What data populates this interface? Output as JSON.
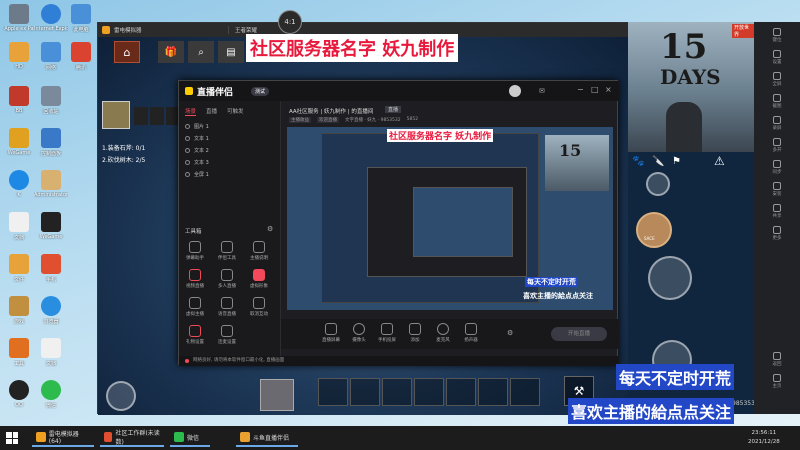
{
  "desktop": {
    "icons": [
      {
        "label": "Apple ex Pa",
        "color": "#6c7a8a"
      },
      {
        "label": "Internet Explorer",
        "color": "#2f7fd6"
      },
      {
        "label": "此电脑",
        "color": "#4a90d9"
      },
      {
        "label": "HD",
        "color": "#e8a23a"
      },
      {
        "label": "网络",
        "color": "#4a90d9"
      },
      {
        "label": "腾讯",
        "color": "#d9432f"
      },
      {
        "label": "BB",
        "color": "#c0392b"
      },
      {
        "label": "回收站",
        "color": "#7a8a9a"
      },
      {
        "label": "WeGame",
        "color": "#e0a020"
      },
      {
        "label": "控制面板",
        "color": "#3a78c8"
      },
      {
        "label": "K",
        "color": "#1e88e5"
      },
      {
        "label": "Administrator",
        "color": "#d8b070"
      },
      {
        "label": "文档",
        "color": "#f0f0f0"
      },
      {
        "label": "WeGame",
        "color": "#222"
      },
      {
        "label": "文件",
        "color": "#e8a23a"
      },
      {
        "label": "手机",
        "color": "#e05030"
      },
      {
        "label": "游戏",
        "color": "#c09040"
      },
      {
        "label": "浏览器",
        "color": "#2a8ee0"
      },
      {
        "label": "工具",
        "color": "#e07020"
      },
      {
        "label": "文档",
        "color": "#f0f0f0"
      },
      {
        "label": "QQ",
        "color": "#222"
      },
      {
        "label": "微信",
        "color": "#2dbb4e"
      }
    ]
  },
  "emulator": {
    "title": "雷电模拟器",
    "tab": "王者荣耀",
    "clock": "4:1",
    "quests": [
      "1.装备石斧: 0/1",
      "2.砍伐树木: 2/5"
    ]
  },
  "stream_app": {
    "logo": "直播伴侣",
    "badge": "测试",
    "left_tabs": [
      "场景",
      "直播",
      "可触发"
    ],
    "layers": [
      "图片 1",
      "文本 1",
      "文本 2",
      "文本 3",
      "全屏 1"
    ],
    "tools_title": "工具箱",
    "tools": [
      "弹幕助手",
      "伴侣工具",
      "主播说明",
      "视频直播",
      "多人直播",
      "虚拟形象",
      "虚拟主播",
      "语音直播",
      "取消互动",
      "礼物设置",
      "连麦设置"
    ],
    "room_title": "AA社区服务 | 妖九制作 | 的直播间",
    "room_badge": "直播",
    "room_meta": [
      "主播收益",
      "欢迎直播",
      "文字直播 · 妖九 · 9853532",
      "5852"
    ],
    "bottom_tools": [
      "直播屏幕",
      "摄像头",
      "手机投屏",
      "添加",
      "麦克风",
      "扬声器"
    ],
    "start_button": "开始直播",
    "status_text": "网络良好, 请勿将本软件窗口最小化, 直播画面"
  },
  "overlays": {
    "server_name": "社区服务器名字  妖九制作",
    "banner_small": "社区服务器名字  妖九制作",
    "update_notice": "每天不定时开荒",
    "follow_notice": "喜欢主播的給点点关注",
    "poster_number": "15",
    "poster_word": "DAYS",
    "poster_tag": "开放世界",
    "viewer_id": "9853532",
    "ge_label": "SACE"
  },
  "side_toolbar": [
    "键位",
    "设置",
    "全屏",
    "截图",
    "录屏",
    "多开",
    "同步",
    "安装",
    "共享",
    "更多",
    "返回",
    "主页"
  ],
  "taskbar": {
    "items": [
      {
        "label": "雷电模拟器(64)",
        "color": "#f0a020"
      },
      {
        "label": "社区工作群(未读数)",
        "color": "#e05030"
      },
      {
        "label": "微信",
        "color": "#2dbb4e"
      },
      {
        "label": "斗鱼直播伴侣",
        "color": "#e8a030"
      }
    ],
    "time": "23:56:11",
    "date": "2021/12/28"
  }
}
